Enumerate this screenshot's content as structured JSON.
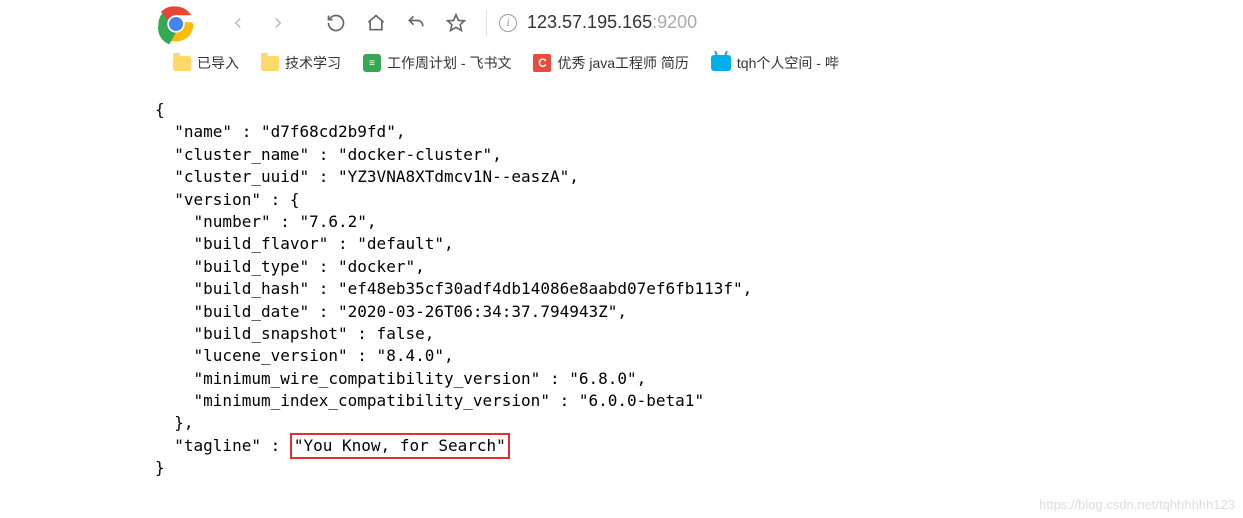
{
  "url": {
    "ip": "123.57.195.165",
    "port": ":9200"
  },
  "bookmarks": {
    "b1": "已导入",
    "b2": "技术学习",
    "b3": "工作周计划 - 飞书文",
    "b4": "优秀 java工程师 简历",
    "b5": "tqh个人空间 - 哔"
  },
  "json": {
    "open": "{",
    "l1": "  \"name\" : \"d7f68cd2b9fd\",",
    "l2": "  \"cluster_name\" : \"docker-cluster\",",
    "l3": "  \"cluster_uuid\" : \"YZ3VNA8XTdmcv1N--easzA\",",
    "l4": "  \"version\" : {",
    "l5": "    \"number\" : \"7.6.2\",",
    "l6": "    \"build_flavor\" : \"default\",",
    "l7": "    \"build_type\" : \"docker\",",
    "l8": "    \"build_hash\" : \"ef48eb35cf30adf4db14086e8aabd07ef6fb113f\",",
    "l9": "    \"build_date\" : \"2020-03-26T06:34:37.794943Z\",",
    "l10": "    \"build_snapshot\" : false,",
    "l11": "    \"lucene_version\" : \"8.4.0\",",
    "l12": "    \"minimum_wire_compatibility_version\" : \"6.8.0\",",
    "l13": "    \"minimum_index_compatibility_version\" : \"6.0.0-beta1\"",
    "l14": "  },",
    "tagline_key": "  \"tagline\" : ",
    "tagline_val": "\"You Know, for Search\"",
    "close": "}"
  },
  "watermark": "https://blog.csdn.net/tqhhhhhh123"
}
